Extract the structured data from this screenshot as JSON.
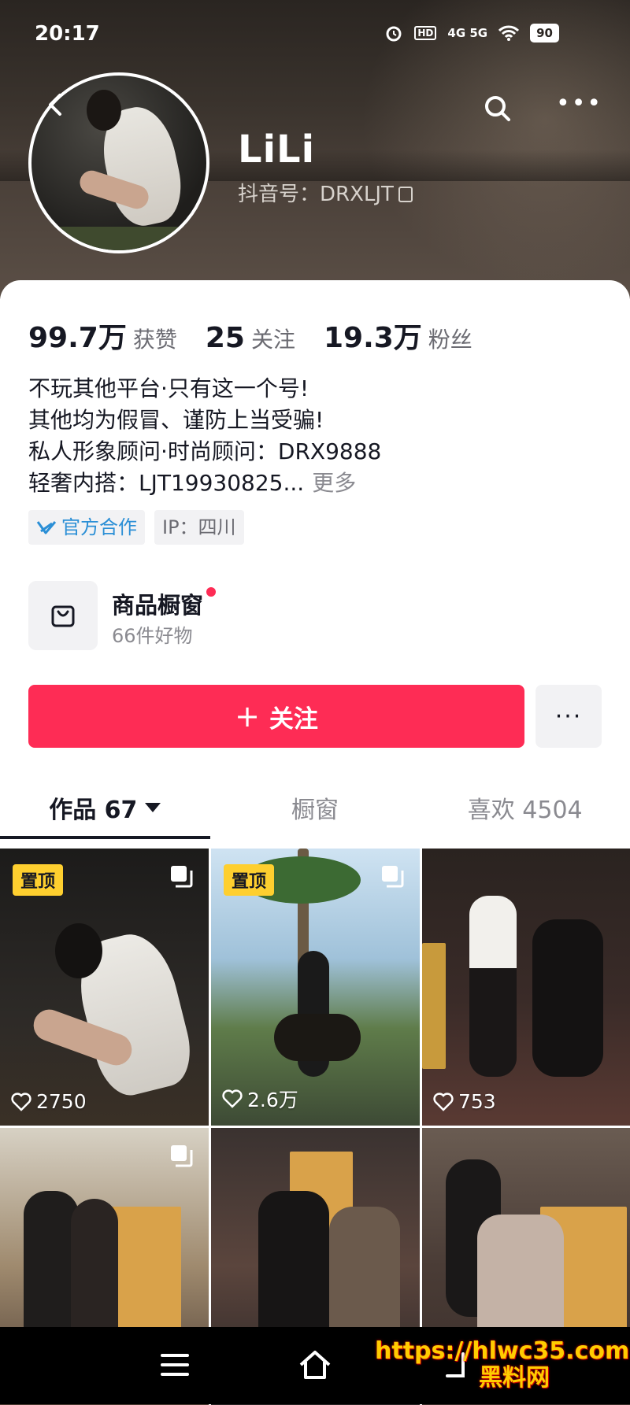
{
  "status_bar": {
    "time": "20:17",
    "network": "4G  5G",
    "battery": "90"
  },
  "profile": {
    "name": "LiLi",
    "douyin_id": "抖音号：DRXLJT",
    "stats": [
      {
        "value": "99.7万",
        "label": "获赞"
      },
      {
        "value": "25",
        "label": "关注"
      },
      {
        "value": "19.3万",
        "label": "粉丝"
      }
    ],
    "bio_lines": [
      "不玩其他平台·只有这一个号!",
      "其他均为假冒、谨防上当受骗!",
      "私人形象顾问·时尚顾问：DRX9888",
      "轻奢内搭：LJT19930825..."
    ],
    "bio_more": "更多",
    "tags": {
      "official": "官方合作",
      "ip": "IP：四川"
    }
  },
  "shop": {
    "title": "商品橱窗",
    "subtitle": "66件好物"
  },
  "actions": {
    "follow": "关注",
    "more": "···"
  },
  "tabs": [
    {
      "label": "作品 67"
    },
    {
      "label": "橱窗"
    },
    {
      "label": "喜欢 4504"
    }
  ],
  "videos": [
    {
      "likes": "2750",
      "pinned": "置顶"
    },
    {
      "likes": "2.6万",
      "pinned": "置顶"
    },
    {
      "likes": "753"
    },
    {
      "likes": ""
    },
    {
      "likes": ""
    },
    {
      "likes": ""
    }
  ],
  "watermark": {
    "line1": "https://hlwc35.com",
    "line2": "黑料网"
  },
  "colors": {
    "accent": "#fe2c55",
    "pin": "#fecf2f",
    "official": "#2b8fd6"
  }
}
